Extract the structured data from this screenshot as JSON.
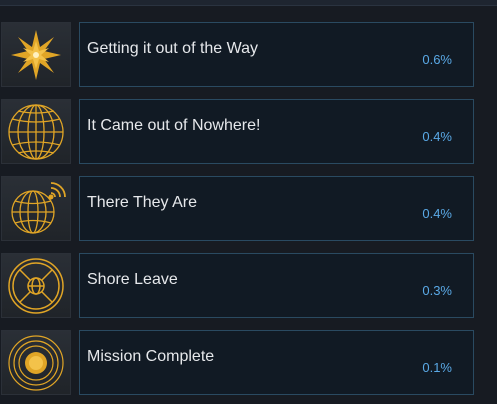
{
  "achievements": [
    {
      "title": "Getting it out of the Way",
      "percent": "0.6%",
      "icon": "star-burst-icon"
    },
    {
      "title": "It Came out of Nowhere!",
      "percent": "0.4%",
      "icon": "globe-grid-icon"
    },
    {
      "title": "There They Are",
      "percent": "0.4%",
      "icon": "globe-signal-icon"
    },
    {
      "title": "Shore Leave",
      "percent": "0.3%",
      "icon": "porthole-globe-icon"
    },
    {
      "title": "Mission Complete",
      "percent": "0.1%",
      "icon": "solar-orbit-icon"
    }
  ],
  "colors": {
    "icon_gold": "#e0a526",
    "percent_blue": "#5aa9e6",
    "row_border": "#2a4a61",
    "row_bg": "#111a24",
    "page_bg": "#171b22"
  }
}
